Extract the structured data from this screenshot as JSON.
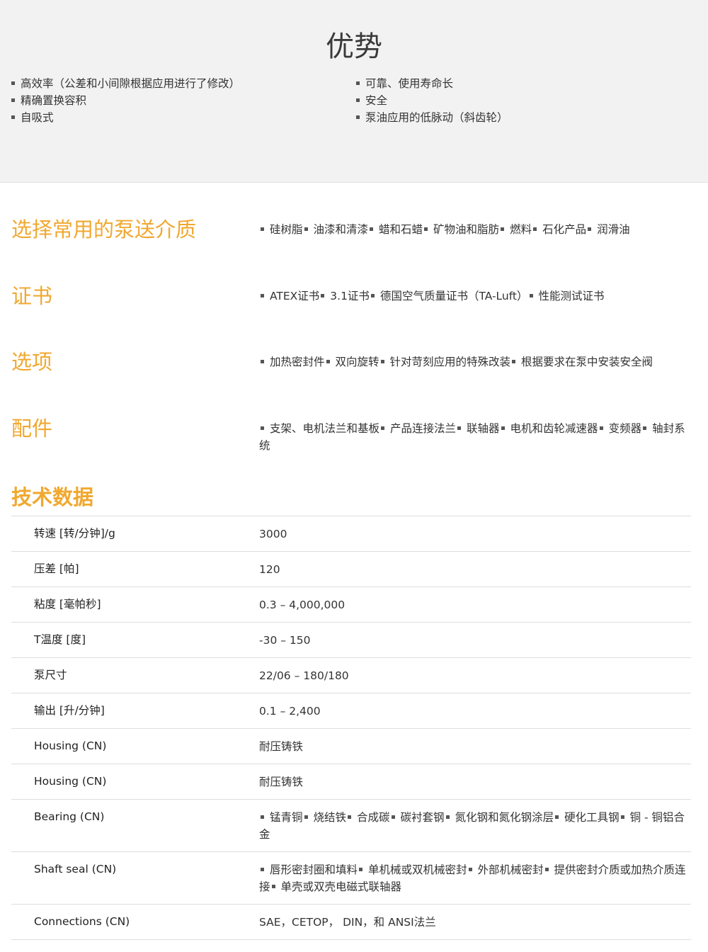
{
  "advantages": {
    "title": "优势",
    "left_items": [
      "高效率（公差和小间隙根据应用进行了修改）",
      "精确置换容积",
      "自吸式"
    ],
    "right_items": [
      "可靠、使用寿命长",
      "安全",
      "泵油应用的低脉动（斜齿轮）"
    ]
  },
  "sections": [
    {
      "title": "选择常用的泵送介质",
      "items": [
        "硅树脂",
        "油漆和清漆",
        "蜡和石蜡",
        "矿物油和脂肪",
        "燃料",
        "石化产品",
        "润滑油"
      ]
    },
    {
      "title": "证书",
      "items": [
        "ATEX证书",
        "3.1证书",
        "德国空气质量证书（TA-Luft）",
        "性能测试证书"
      ]
    },
    {
      "title": "选项",
      "items": [
        "加热密封件",
        "双向旋转",
        "针对苛刻应用的特殊改装",
        "根据要求在泵中安装安全阀"
      ]
    },
    {
      "title": "配件",
      "items": [
        "支架、电机法兰和基板",
        "产品连接法兰",
        "联轴器",
        "电机和齿轮减速器",
        "变频器",
        "轴封系统"
      ]
    }
  ],
  "tech": {
    "title": "技术数据",
    "rows": [
      {
        "label": "转速 [转/分钟]/g",
        "value": "3000"
      },
      {
        "label": "压差 [帕]",
        "value": "120"
      },
      {
        "label": "粘度 [毫帕秒]",
        "value": "0.3 – 4,000,000"
      },
      {
        "label": "T温度 [度]",
        "value": "-30 – 150"
      },
      {
        "label": "泵尺寸",
        "value": "22/06 – 180/180"
      },
      {
        "label": "输出 [升/分钟]",
        "value": "0.1 – 2,400"
      },
      {
        "label": "Housing (CN)",
        "value": "耐压铸铁"
      },
      {
        "label": "Housing (CN)",
        "value": "耐压铸铁"
      },
      {
        "label": "Bearing (CN)",
        "items": [
          "锰青铜",
          "烧结铁",
          "合成碳",
          "碳衬套钢",
          "氮化钢和氮化钢涂层",
          "硬化工具钢",
          "铜 - 铜铝合金"
        ]
      },
      {
        "label": "Shaft seal (CN)",
        "items": [
          "唇形密封圈和填料",
          "单机械或双机械密封",
          "外部机械密封",
          "提供密封介质或加热介质连接",
          "单壳或双壳电磁式联轴器"
        ]
      },
      {
        "label": "Connections (CN)",
        "value": "SAE，CETOP， DIN，和 ANSI法兰"
      }
    ]
  },
  "colors": {
    "accent": "#f0a830",
    "band": "#f2f2f2",
    "divider": "#dedede"
  }
}
